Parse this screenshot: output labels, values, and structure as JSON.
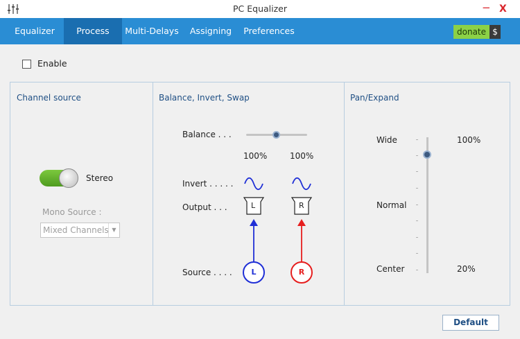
{
  "window": {
    "title": "PC Equalizer"
  },
  "nav": {
    "tabs": [
      "Equalizer",
      "Process",
      "Multi-Delays",
      "Assigning",
      "Preferences"
    ],
    "active": 1,
    "donate_label": "donate",
    "donate_symbol": "$"
  },
  "enable": {
    "label": "Enable",
    "checked": false
  },
  "channel_source": {
    "title": "Channel source",
    "toggle_label": "Stereo",
    "toggle_on": true,
    "mono_source_label": "Mono Source :",
    "mono_source_value": "Mixed Channels"
  },
  "balance_panel": {
    "title": "Balance, Invert, Swap",
    "balance_label": "Balance . . .",
    "balance_value": 0.5,
    "left_pct": "100%",
    "right_pct": "100%",
    "invert_label": "Invert . . . . .",
    "output_label": "Output  . . .",
    "source_label": "Source . . . .",
    "left_output": "L",
    "right_output": "R",
    "left_source": "L",
    "right_source": "R"
  },
  "pan_panel": {
    "title": "Pan/Expand",
    "wide_label": "Wide",
    "wide_pct": "100%",
    "normal_label": "Normal",
    "center_label": "Center",
    "center_pct": "20%",
    "value_fraction": 0.875
  },
  "buttons": {
    "default_label": "Default"
  },
  "colors": {
    "accent": "#2a8dd4",
    "left": "#1f2fd6",
    "right": "#e61e1e",
    "toggle": "#6bb52e"
  },
  "icons": {
    "app": "equalizer-sliders-icon",
    "minimize": "minimize-icon",
    "close": "close-icon"
  }
}
